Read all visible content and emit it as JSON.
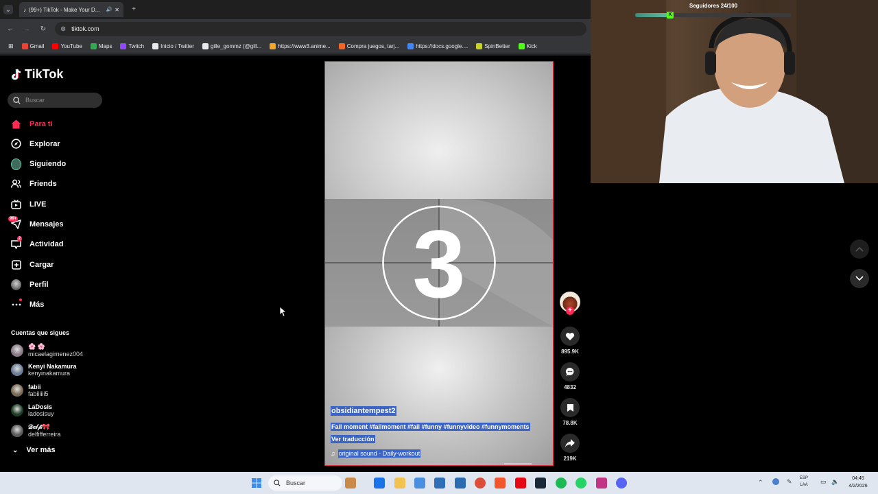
{
  "browser": {
    "tab_title": "(99+) TikTok - Make Your D...",
    "url": "tiktok.com",
    "bookmarks": [
      {
        "label": "Gmail",
        "color": "#ea4335"
      },
      {
        "label": "YouTube",
        "color": "#ff0000"
      },
      {
        "label": "Maps",
        "color": "#34a853"
      },
      {
        "label": "Twitch",
        "color": "#9146ff"
      },
      {
        "label": "Inicio / Twitter",
        "color": "#e8eaed"
      },
      {
        "label": "gille_gommz (@gill...",
        "color": "#e8eaed"
      },
      {
        "label": "https://www3.anime...",
        "color": "#f5a623"
      },
      {
        "label": "Compra juegos, tarj...",
        "color": "#f26522"
      },
      {
        "label": "https://docs.google....",
        "color": "#4285f4"
      },
      {
        "label": "SpinBetter",
        "color": "#c6d22a"
      },
      {
        "label": "Kick",
        "color": "#53fc18"
      }
    ]
  },
  "tiktok": {
    "logo": "TikTok",
    "search_placeholder": "Buscar",
    "nav": [
      {
        "label": "Para ti",
        "icon": "home-icon",
        "active": true
      },
      {
        "label": "Explorar",
        "icon": "compass-icon"
      },
      {
        "label": "Siguiendo",
        "icon": "following-avatar-icon"
      },
      {
        "label": "Friends",
        "icon": "friends-icon"
      },
      {
        "label": "LIVE",
        "icon": "live-icon"
      },
      {
        "label": "Mensajes",
        "icon": "messages-icon",
        "badge": "99+"
      },
      {
        "label": "Actividad",
        "icon": "activity-icon",
        "badge": "2"
      },
      {
        "label": "Cargar",
        "icon": "upload-icon"
      },
      {
        "label": "Perfil",
        "icon": "profile-icon"
      },
      {
        "label": "Más",
        "icon": "more-icon"
      }
    ],
    "following_title": "Cuentas que sigues",
    "following": [
      {
        "name": "🌸 🌸",
        "handle": "micaelagimenez004",
        "color": "#8a7a86"
      },
      {
        "name": "Kenyi Nakamura",
        "handle": "kenyinakamura",
        "color": "#6b7c96"
      },
      {
        "name": "fabii",
        "handle": "fabiiiiii5",
        "color": "#7a6a55"
      },
      {
        "name": "LaDosis",
        "handle": "ladosisuy",
        "color": "#1f3d26"
      },
      {
        "name": "𝒟𝑒𝓁𝒻𝒾🎀",
        "handle": "delfifferreira",
        "color": "#5a5a5a"
      }
    ],
    "see_more": "Ver más",
    "video": {
      "countdown_number": "3",
      "username": "obsidiantempest2",
      "description": "Fail moment #failmoment #fail #funny #funnyvideo #funnymoments",
      "translate": "Ver traducción",
      "sound": "original sound - Daily-workout"
    },
    "actions": {
      "likes": "895.9K",
      "comments": "4832",
      "saves": "78.8K",
      "shares": "219K"
    }
  },
  "stream_overlay": {
    "goal_label": "Seguidores 24/100",
    "goal_progress": 0.24
  },
  "taskbar": {
    "search_placeholder": "Buscar",
    "lang_top": "ESP",
    "lang_bottom": "LAA",
    "time": "04:45",
    "date": "4/2/2026"
  }
}
